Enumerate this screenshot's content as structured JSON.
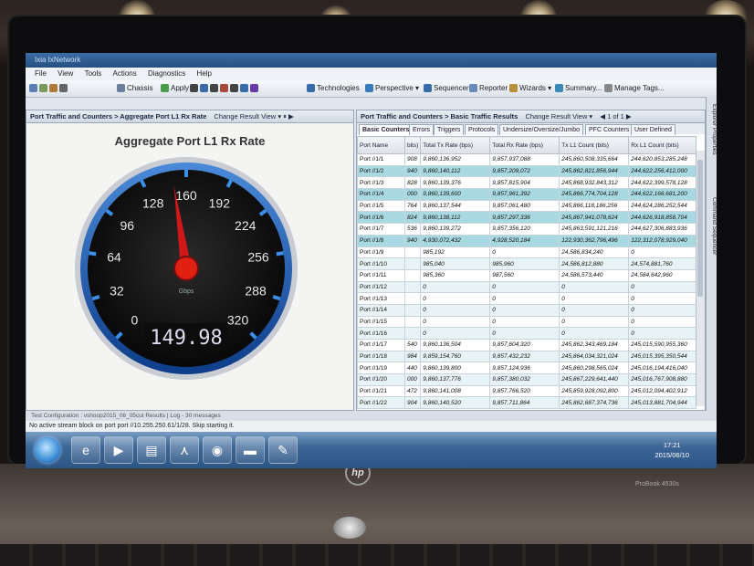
{
  "window": {
    "title": "Ixia IxNetwork"
  },
  "menu": [
    "File",
    "View",
    "Tools",
    "Actions",
    "Diagnostics",
    "Help"
  ],
  "toolbar": {
    "chassis": "Chassis",
    "apply": "Apply",
    "technologies": "Technologies",
    "perspective": "Perspective",
    "sequencer": "Sequencer",
    "reporter": "Reporter",
    "wizards": "Wizards",
    "summary": "Summary...",
    "manage_tags": "Manage Tags..."
  },
  "left_panel": {
    "header": "Port Traffic and Counters > Aggregate Port L1 Rx Rate",
    "change_view": "Change Result View",
    "gauge": {
      "title": "Aggregate Port L1 Rx Rate",
      "ticks": [
        "0",
        "32",
        "64",
        "96",
        "128",
        "160",
        "192",
        "224",
        "256",
        "288",
        "320"
      ],
      "min": 0,
      "max": 320,
      "value": 149.98,
      "readout": "149.98",
      "unit": "Gbps"
    }
  },
  "right_panel": {
    "header": "Port Traffic and Counters > Basic Traffic Results",
    "change_view": "Change Result View",
    "pager": "1 of 1",
    "tabs": [
      "Basic Counters",
      "Errors",
      "Triggers",
      "Protocols",
      "Undersize/Oversize/Jumbo",
      "PFC Counters",
      "User Defined"
    ],
    "columns": [
      "Port Name",
      "bits)",
      "Total Tx Rate (bps)",
      "Total Rx Rate (bps)",
      "Tx L1 Count (bits)",
      "Rx L1 Count (bits)"
    ],
    "rows": [
      [
        "Port //1/1",
        "908",
        "9,860,136,952",
        "9,857,937,088",
        "245,860,508,335,664",
        "244,620,853,285,248"
      ],
      [
        "Port //1/2",
        "940",
        "9,860,140,112",
        "9,857,209,072",
        "245,862,821,856,944",
        "244,622,256,412,000"
      ],
      [
        "Port //1/3",
        "828",
        "9,860,139,376",
        "9,857,815,904",
        "245,868,932,843,312",
        "244,622,399,578,128"
      ],
      [
        "Port //1/4",
        "000",
        "9,860,139,600",
        "9,857,961,392",
        "245,866,774,704,128",
        "244,622,166,681,200"
      ],
      [
        "Port //1/5",
        "764",
        "9,860,137,544",
        "9,857,061,480",
        "245,866,118,186,256",
        "244,624,286,252,544"
      ],
      [
        "Port //1/6",
        "824",
        "9,860,138,112",
        "9,857,297,336",
        "245,867,941,078,624",
        "244,626,918,858,704"
      ],
      [
        "Port //1/7",
        "536",
        "9,860,139,272",
        "9,857,356,120",
        "245,863,591,121,216",
        "244,627,306,883,936"
      ],
      [
        "Port //1/8",
        "940",
        "4,930,072,432",
        "4,928,520,184",
        "122,930,362,796,496",
        "122,312,078,929,040"
      ],
      [
        "Port //1/9",
        "",
        "985,192",
        "0",
        "24,586,834,240",
        "0"
      ],
      [
        "Port //1/10",
        "",
        "985,040",
        "985,960",
        "24,586,812,880",
        "24,574,881,760"
      ],
      [
        "Port //1/11",
        "",
        "985,360",
        "987,560",
        "24,586,573,440",
        "24,584,642,960"
      ],
      [
        "Port //1/12",
        "",
        "0",
        "0",
        "0",
        "0"
      ],
      [
        "Port //1/13",
        "",
        "0",
        "0",
        "0",
        "0"
      ],
      [
        "Port //1/14",
        "",
        "0",
        "0",
        "0",
        "0"
      ],
      [
        "Port //1/15",
        "",
        "0",
        "0",
        "0",
        "0"
      ],
      [
        "Port //1/16",
        "",
        "0",
        "0",
        "0",
        "0"
      ],
      [
        "Port //1/17",
        "540",
        "9,860,136,504",
        "9,857,604,320",
        "245,862,343,469,184",
        "245,015,590,955,360"
      ],
      [
        "Port //1/18",
        "984",
        "9,859,154,760",
        "9,857,432,232",
        "245,864,034,321,024",
        "245,015,395,350,544"
      ],
      [
        "Port //1/19",
        "440",
        "9,860,139,800",
        "9,857,124,936",
        "245,860,298,565,024",
        "245,016,194,416,040"
      ],
      [
        "Port //1/20",
        "000",
        "9,860,137,776",
        "9,857,380,032",
        "245,867,229,641,440",
        "245,016,767,908,880"
      ],
      [
        "Port //1/21",
        "472",
        "9,860,141,008",
        "9,857,766,520",
        "245,859,928,092,800",
        "245,012,094,402,912"
      ],
      [
        "Port //1/22",
        "904",
        "9,860,140,520",
        "9,857,711,864",
        "245,862,687,374,736",
        "245,013,881,704,944"
      ]
    ]
  },
  "side_tabs": [
    "Explorer Properties",
    "Command Sequencer"
  ],
  "status": {
    "test_config": "Test Configuration : vshoop2015_06_05cut Results",
    "log": "Log - 30 messages",
    "message": "No active stream block on port port //10.255.250.61/1/28. Skip starting it."
  },
  "taskbar": {
    "time": "17:21",
    "date": "2015/06/10"
  },
  "laptop": {
    "brand": "hp",
    "model": "ProBook 4530s"
  }
}
